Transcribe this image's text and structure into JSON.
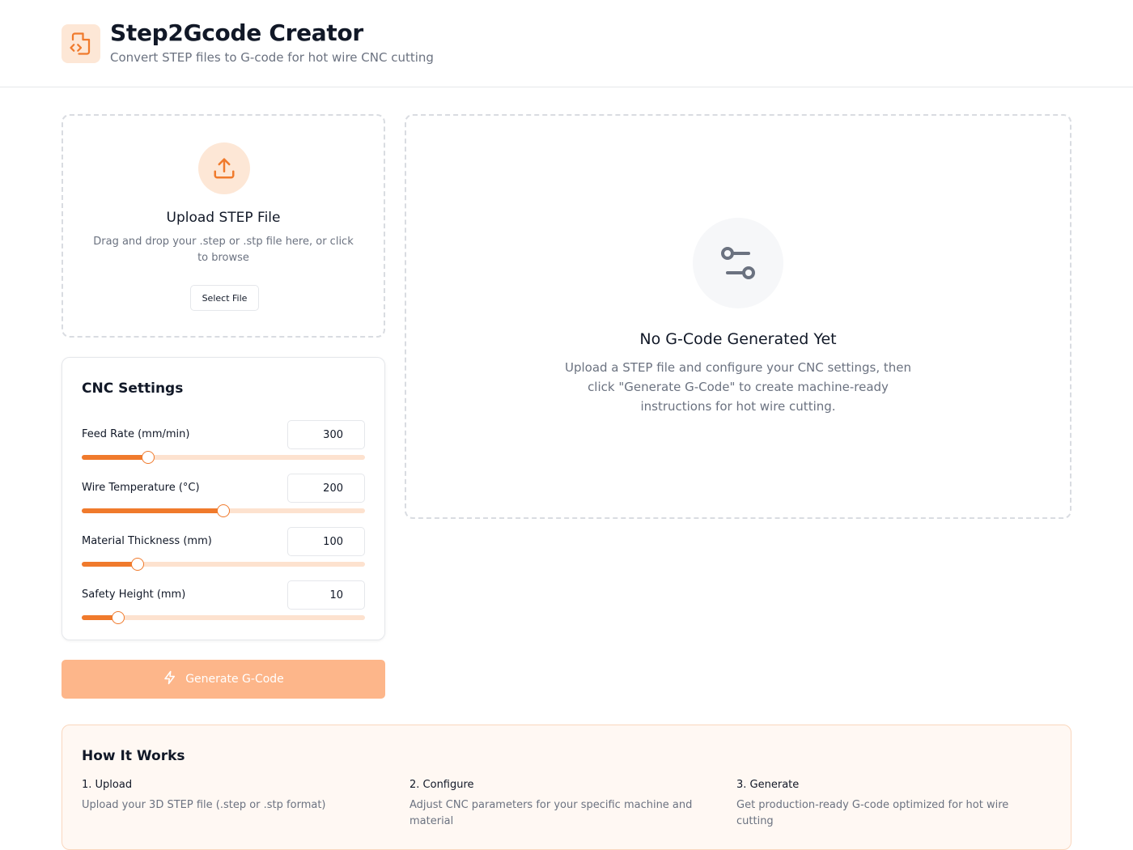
{
  "app": {
    "title": "Step2Gcode Creator",
    "subtitle": "Convert STEP files to G-code for hot wire CNC cutting"
  },
  "upload": {
    "title": "Upload STEP File",
    "description": "Drag and drop your .step or .stp file here, or click to browse",
    "button_label": "Select File"
  },
  "settings": {
    "title": "CNC Settings",
    "items": [
      {
        "label": "Feed Rate (mm/min)",
        "value": "300",
        "fraction": 0.234
      },
      {
        "label": "Wire Temperature (°C)",
        "value": "200",
        "fraction": 0.5
      },
      {
        "label": "Material Thickness (mm)",
        "value": "100",
        "fraction": 0.197
      },
      {
        "label": "Safety Height (mm)",
        "value": "10",
        "fraction": 0.129
      }
    ]
  },
  "generate": {
    "label": "Generate G-Code",
    "enabled": false
  },
  "output": {
    "title": "No G-Code Generated Yet",
    "description": "Upload a STEP file and configure your CNC settings, then click \"Generate G-Code\" to create machine-ready instructions for hot wire cutting."
  },
  "how_it_works": {
    "title": "How It Works",
    "steps": [
      {
        "title": "1. Upload",
        "description": "Upload your 3D STEP file (.step or .stp format)"
      },
      {
        "title": "2. Configure",
        "description": "Adjust CNC parameters for your specific machine and material"
      },
      {
        "title": "3. Generate",
        "description": "Get production-ready G-code optimized for hot wire cutting"
      }
    ]
  },
  "colors": {
    "accent": "#f07a2c",
    "accent_light": "#fde2cf",
    "button_disabled": "#fdb68a",
    "text_primary": "#111827",
    "text_muted": "#6b7280"
  },
  "icons": {
    "logo": "file-code-icon",
    "upload": "upload-icon",
    "output": "sliders-icon",
    "generate": "lightning-icon"
  }
}
